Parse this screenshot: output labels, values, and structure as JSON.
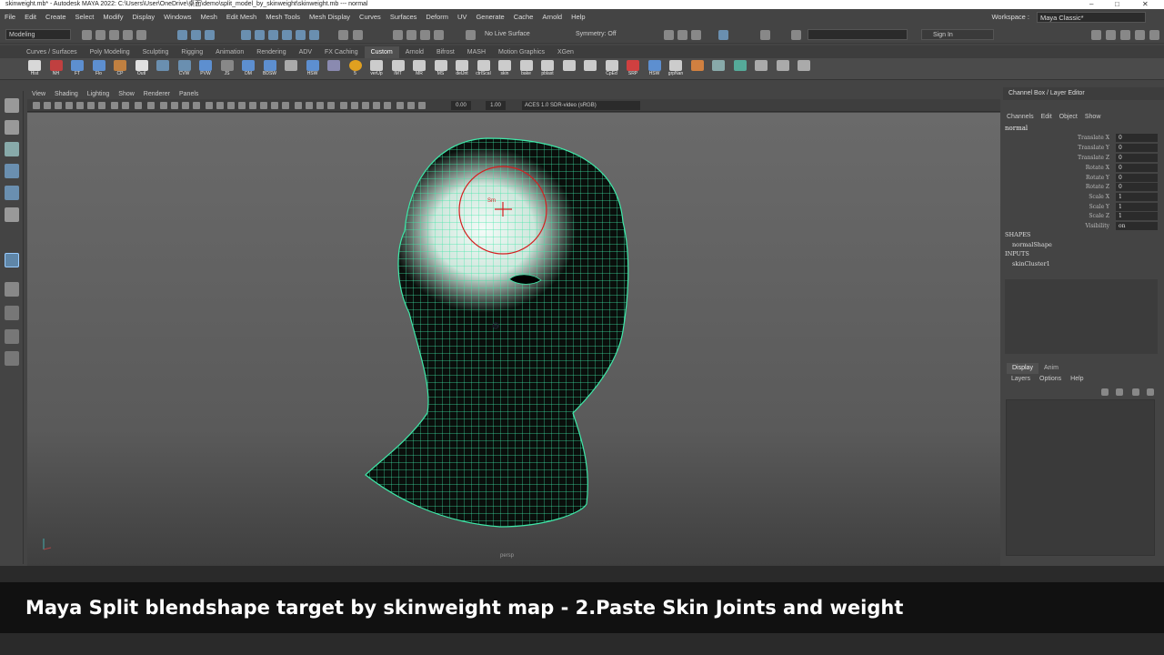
{
  "title_bar": {
    "text": "skinweight.mb* - Autodesk MAYA 2022: C:\\Users\\User\\OneDrive\\桌面\\demo\\split_model_by_skinweight\\skinweight.mb  ---  normal"
  },
  "menus": [
    "File",
    "Edit",
    "Create",
    "Select",
    "Modify",
    "Display",
    "Windows",
    "Mesh",
    "Edit Mesh",
    "Mesh Tools",
    "Mesh Display",
    "Curves",
    "Surfaces",
    "Deform",
    "UV",
    "Generate",
    "Cache",
    "Arnold",
    "Help"
  ],
  "workspace": {
    "label": "Workspace :",
    "value": "Maya Classic*"
  },
  "status_line": {
    "mode": "Modeling",
    "live_surface": "No Live Surface",
    "symmetry": "Symmetry: Off",
    "sign_in": "Sign In"
  },
  "shelf_tabs": [
    "Curves / Surfaces",
    "Poly Modeling",
    "Sculpting",
    "Rigging",
    "Animation",
    "Rendering",
    "ADV",
    "FX Caching",
    "Custom",
    "Arnold",
    "Bifrost",
    "MASH",
    "Motion Graphics",
    "XGen"
  ],
  "shelf_active_tab": "Custom",
  "shelf_buttons": [
    "Hist",
    "NH",
    "FT",
    "Flo",
    "CP",
    "Outl",
    "",
    "CVW",
    "PVW",
    "JS",
    "DM",
    "BDSW",
    "",
    "HSW",
    "",
    "5",
    "verUp",
    "IMT",
    "MR",
    "MS",
    "delJnt",
    "ctrlScal",
    "skin",
    "bake",
    "pblast",
    "",
    "",
    "CpEd",
    "SRP",
    "HSW",
    "grpNan",
    "",
    "",
    "",
    "",
    "",
    ""
  ],
  "viewport": {
    "menus": [
      "View",
      "Shading",
      "Lighting",
      "Show",
      "Renderer",
      "Panels"
    ],
    "gamma": "0.00",
    "exposure": "1.00",
    "color_space": "ACES 1.0 SDR-video (sRGB)",
    "camera": "persp",
    "brush_label": "Sm"
  },
  "channel_box": {
    "header": "Channel Box / Layer Editor",
    "menus": [
      "Channels",
      "Edit",
      "Object",
      "Show"
    ],
    "object": "normal",
    "attributes": [
      {
        "name": "Translate X",
        "value": "0"
      },
      {
        "name": "Translate Y",
        "value": "0"
      },
      {
        "name": "Translate Z",
        "value": "0"
      },
      {
        "name": "Rotate X",
        "value": "0"
      },
      {
        "name": "Rotate Y",
        "value": "0"
      },
      {
        "name": "Rotate Z",
        "value": "0"
      },
      {
        "name": "Scale X",
        "value": "1"
      },
      {
        "name": "Scale Y",
        "value": "1"
      },
      {
        "name": "Scale Z",
        "value": "1"
      },
      {
        "name": "Visibility",
        "value": "on"
      }
    ],
    "shapes_label": "SHAPES",
    "shape_item": "normalShape",
    "inputs_label": "INPUTS",
    "input_item": "skinCluster1"
  },
  "layer_editor": {
    "tabs": [
      "Display",
      "Anim"
    ],
    "active_tab": "Display",
    "menus": [
      "Layers",
      "Options",
      "Help"
    ]
  },
  "caption": "Maya Split blendshape target by skinweight map - 2.Paste Skin Joints and weight",
  "colors": {
    "wire": "#3ee8a8",
    "brush": "#d32020",
    "accent": "#6a8fb0"
  }
}
